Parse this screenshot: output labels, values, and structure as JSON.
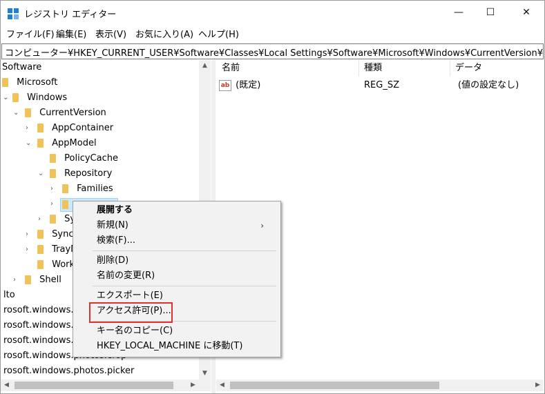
{
  "window": {
    "title": "レジストリ エディター",
    "minimize_glyph": "—",
    "maximize_glyph": "☐",
    "close_glyph": "✕"
  },
  "menu": [
    "ファイル(F)",
    "編集(E)",
    "表示(V)",
    "お気に入り(A)",
    "ヘルプ(H)"
  ],
  "address": "コンピューター¥HKEY_CURRENT_USER¥Software¥Classes¥Local Settings¥Software¥Microsoft¥Windows¥CurrentVersion¥AppMode",
  "tree": {
    "items": [
      {
        "label": "Software"
      },
      {
        "label": "Microsoft"
      },
      {
        "label": "Windows"
      },
      {
        "label": "CurrentVersion"
      },
      {
        "label": "AppContainer"
      },
      {
        "label": "AppModel"
      },
      {
        "label": "PolicyCache"
      },
      {
        "label": "Repository"
      },
      {
        "label": "Families"
      },
      {
        "label": ""
      },
      {
        "label": "Sy"
      },
      {
        "label": "Synch"
      },
      {
        "label": "TrayN"
      },
      {
        "label": "Work"
      },
      {
        "label": "Shell"
      },
      {
        "label": "lto"
      },
      {
        "label": "rosoft.windows.c"
      },
      {
        "label": "rosoft.windows.c"
      },
      {
        "label": "rosoft.windows.c"
      },
      {
        "label": "rosoft.windows.photos.crop"
      },
      {
        "label": "rosoft.windows.photos.picker"
      }
    ]
  },
  "list": {
    "columns": [
      "名前",
      "種類",
      "データ"
    ],
    "rows": [
      {
        "name": "(既定)",
        "type": "REG_SZ",
        "data": "(値の設定なし)",
        "icon": "string-value-icon"
      }
    ]
  },
  "context_menu": {
    "expand": "展開する",
    "new": "新規(N)",
    "find": "検索(F)...",
    "delete": "削除(D)",
    "rename": "名前の変更(R)",
    "export": "エクスポート(E)",
    "permissions": "アクセス許可(P)...",
    "copy_key": "キー名のコピー(C)",
    "goto_hklm": "HKEY_LOCAL_MACHINE に移動(T)",
    "submenu_arrow": "›"
  },
  "colors": {
    "folder": "#f0c35a",
    "highlight_box": "#e0322a",
    "menu_bg": "#f2f2f2"
  }
}
